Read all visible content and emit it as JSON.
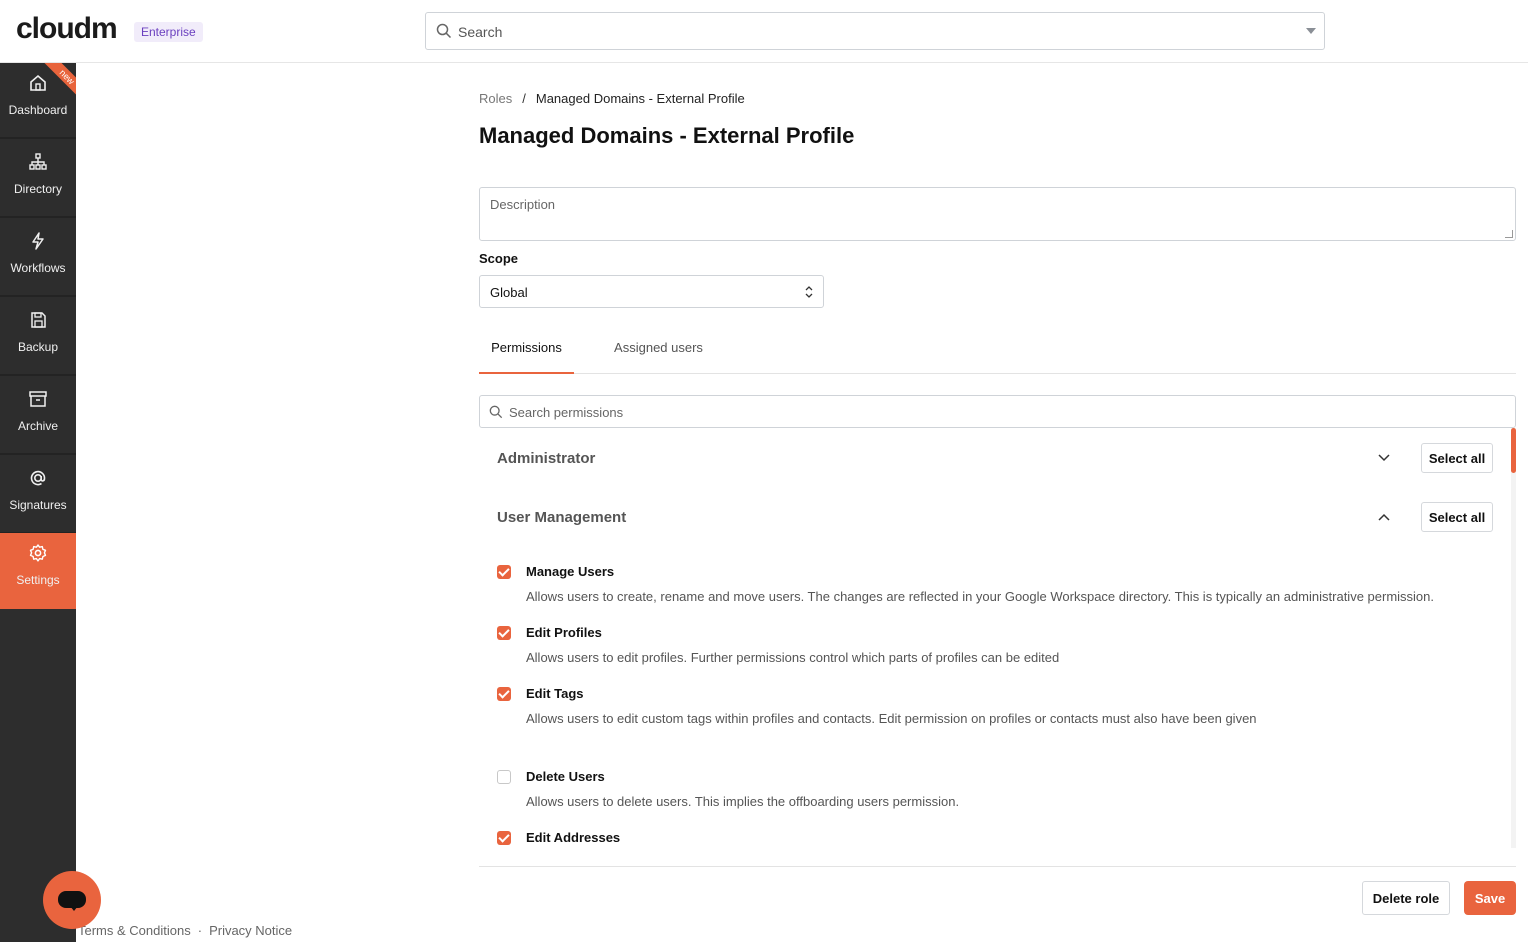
{
  "brand": {
    "logo": "cloudm",
    "badge": "Enterprise"
  },
  "top_search": {
    "placeholder": "Search"
  },
  "sidebar": {
    "new_ribbon": "new",
    "items": [
      {
        "label": "Dashboard",
        "icon": "home-icon"
      },
      {
        "label": "Directory",
        "icon": "org-chart-icon"
      },
      {
        "label": "Workflows",
        "icon": "lightning-icon"
      },
      {
        "label": "Backup",
        "icon": "save-icon"
      },
      {
        "label": "Archive",
        "icon": "archive-box-icon"
      },
      {
        "label": "Signatures",
        "icon": "at-sign-icon"
      },
      {
        "label": "Settings",
        "icon": "gear-icon",
        "active": true
      }
    ]
  },
  "breadcrumb": {
    "root": "Roles",
    "separator": "/",
    "current": "Managed Domains - External Profile"
  },
  "page_title": "Managed Domains - External Profile",
  "description": {
    "placeholder": "Description",
    "value": ""
  },
  "scope": {
    "label": "Scope",
    "selected": "Global"
  },
  "tabs": [
    {
      "label": "Permissions",
      "active": true
    },
    {
      "label": "Assigned users",
      "active": false
    }
  ],
  "permission_search": {
    "placeholder": "Search permissions"
  },
  "groups": [
    {
      "name": "Administrator",
      "expanded": false,
      "select_all_label": "Select all"
    },
    {
      "name": "User Management",
      "expanded": true,
      "select_all_label": "Select all"
    }
  ],
  "permissions": [
    {
      "name": "Manage Users",
      "checked": true,
      "description": "Allows users to create, rename and move users. The changes are reflected in your Google Workspace directory. This is typically an administrative permission."
    },
    {
      "name": "Edit Profiles",
      "checked": true,
      "description": "Allows users to edit profiles. Further permissions control which parts of profiles can be edited"
    },
    {
      "name": "Edit Tags",
      "checked": true,
      "description": "Allows users to edit custom tags within profiles and contacts. Edit permission on profiles or contacts must also have been given"
    },
    {
      "name": "Delete Users",
      "checked": false,
      "description": "Allows users to delete users. This implies the offboarding users permission."
    },
    {
      "name": "Edit Addresses",
      "checked": true,
      "description": ""
    }
  ],
  "actions": {
    "delete_label": "Delete role",
    "save_label": "Save"
  },
  "legal": {
    "terms": "Terms & Conditions",
    "dot": "·",
    "privacy": "Privacy Notice"
  },
  "colors": {
    "accent": "#e9643e",
    "sidebar_bg": "#2d2d2d",
    "badge_bg": "#f1ecfa",
    "badge_text": "#6a3fbf"
  }
}
